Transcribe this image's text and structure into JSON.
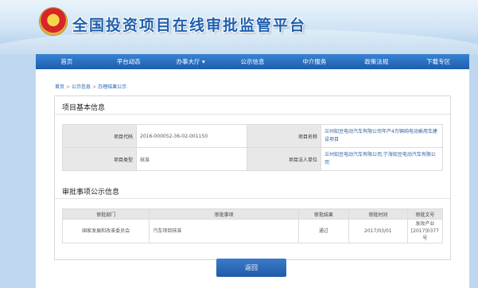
{
  "site": {
    "title": "全国投资项目在线审批监管平台"
  },
  "nav": {
    "items": [
      {
        "label": "首页"
      },
      {
        "label": "平台动态"
      },
      {
        "label": "办事大厅 ▾"
      },
      {
        "label": "公示信息"
      },
      {
        "label": "中介服务"
      },
      {
        "label": "政策法规"
      },
      {
        "label": "下载专区"
      }
    ]
  },
  "breadcrumb": {
    "home": "首页",
    "level2": "公示信息",
    "level3": "办理结果公示",
    "sep": ">"
  },
  "project_info": {
    "section_title": "项目基本信息",
    "code_label": "项目代码",
    "code_value": "2016-000052-36-02-001150",
    "name_label": "项目名称",
    "name_value": "兰州知豆电动汽车有限公司年产4万辆纯电动乘用车建设项目",
    "type_label": "项目类型",
    "type_value": "核准",
    "owner_label": "项目法人单位",
    "owner_value": "兰州知豆电动汽车有限公司,宁海知豆电动汽车有限公司"
  },
  "approval": {
    "section_title": "审批事项公示信息",
    "headers": [
      "审批部门",
      "审批事项",
      "审批结果",
      "审批时间",
      "审批文号"
    ],
    "rows": [
      {
        "dept": "国家发展和改革委员会",
        "item": "汽车项目核准",
        "result": "通过",
        "date": "2017/03/01",
        "doc": "发改产业[2017]0377号"
      }
    ]
  },
  "actions": {
    "back_label": "返回"
  }
}
